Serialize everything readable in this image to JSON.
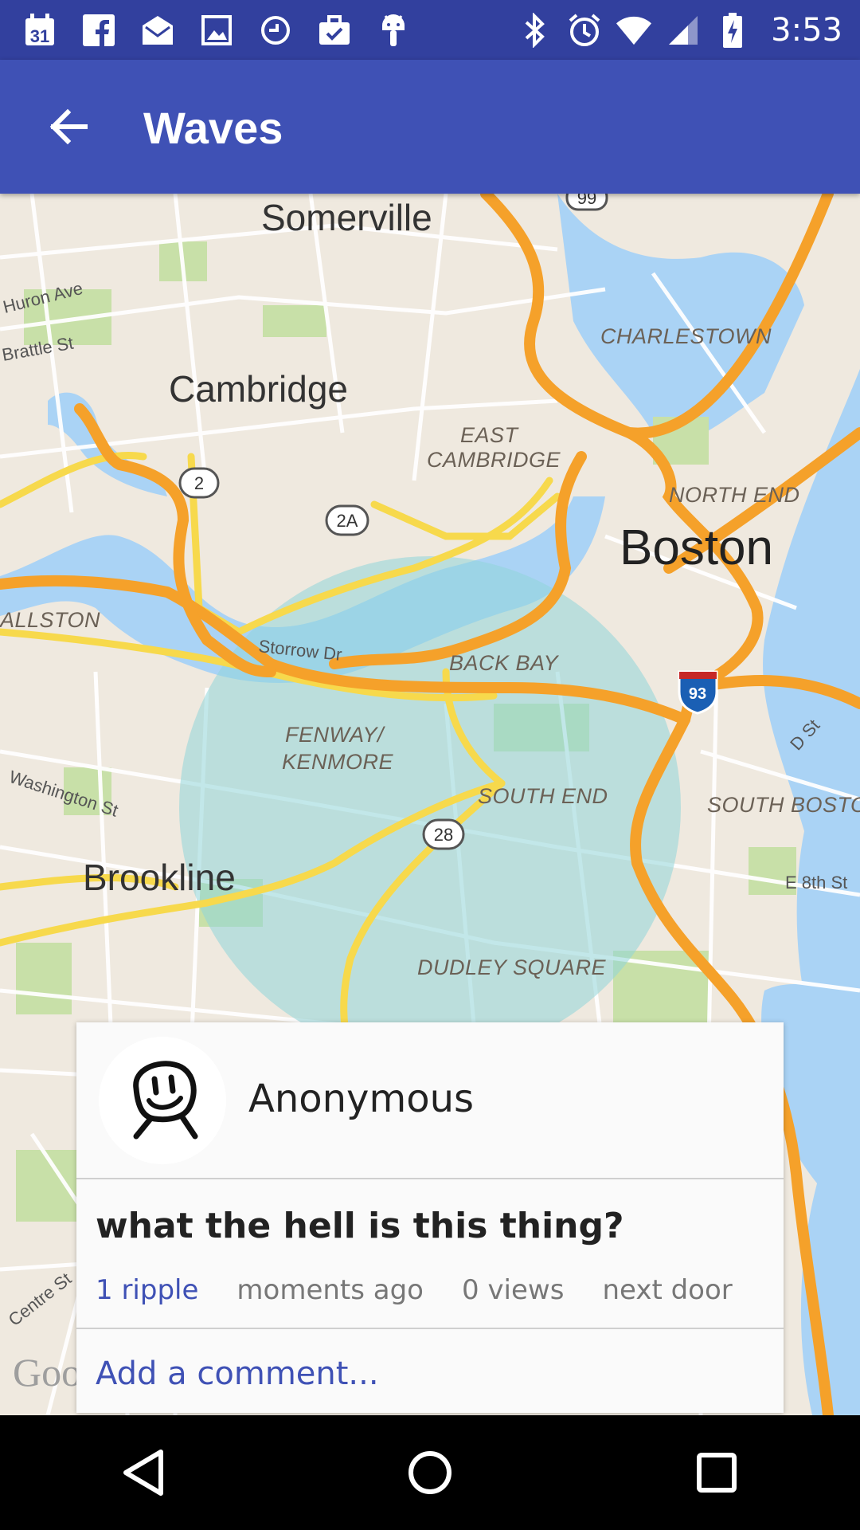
{
  "status_bar": {
    "time": "3:53",
    "left_icons": [
      "calendar-icon",
      "facebook-icon",
      "mail-icon",
      "gallery-icon",
      "clock-app-icon",
      "briefcase-icon",
      "android-icon"
    ],
    "calendar_day": "31",
    "right_icons": [
      "bluetooth-icon",
      "alarm-icon",
      "wifi-icon",
      "signal-icon",
      "battery-icon"
    ]
  },
  "app_bar": {
    "title": "Waves",
    "back_icon": "arrow-left-icon"
  },
  "map": {
    "labels": {
      "somerville": "Somerville",
      "cambridge": "Cambridge",
      "boston": "Boston",
      "brookline": "Brookline",
      "charlestown": "CHARLESTOWN",
      "east_cambridge_1": "EAST",
      "east_cambridge_2": "CAMBRIDGE",
      "north_end": "NORTH END",
      "allston": "ALLSTON",
      "back_bay": "BACK BAY",
      "fenway_1": "FENWAY/",
      "fenway_2": "KENMORE",
      "south_end": "SOUTH END",
      "south_boston": "SOUTH BOSTON",
      "dudley_square": "DUDLEY SQUARE",
      "huron_ave": "Huron Ave",
      "brattle_st": "Brattle St",
      "storrow_dr": "Storrow Dr",
      "washington_st": "Washington St",
      "d_st": "D St",
      "e_8th_st": "E 8th St",
      "centre_st": "Centre St"
    },
    "shields": {
      "route_2": "2",
      "route_2a": "2A",
      "route_28": "28",
      "route_99": "99",
      "interstate_93": "93"
    },
    "attribution": "Goo",
    "colors": {
      "highway": "#f5a12a",
      "arterial": "#f7d94c",
      "water": "#aad3f5",
      "park": "#c8e0a8",
      "land": "#efe9df",
      "radius": "#8fd6d8"
    }
  },
  "post_card": {
    "author": "Anonymous",
    "avatar_icon": "smiley-avatar-icon",
    "text": "what the hell is this thing?",
    "ripples": "1 ripple",
    "time": "moments ago",
    "views": "0 views",
    "distance": "next door",
    "comment_placeholder": "Add a comment..."
  },
  "nav_bar": {
    "back_icon": "nav-back-icon",
    "home_icon": "nav-home-icon",
    "recents_icon": "nav-recents-icon"
  }
}
